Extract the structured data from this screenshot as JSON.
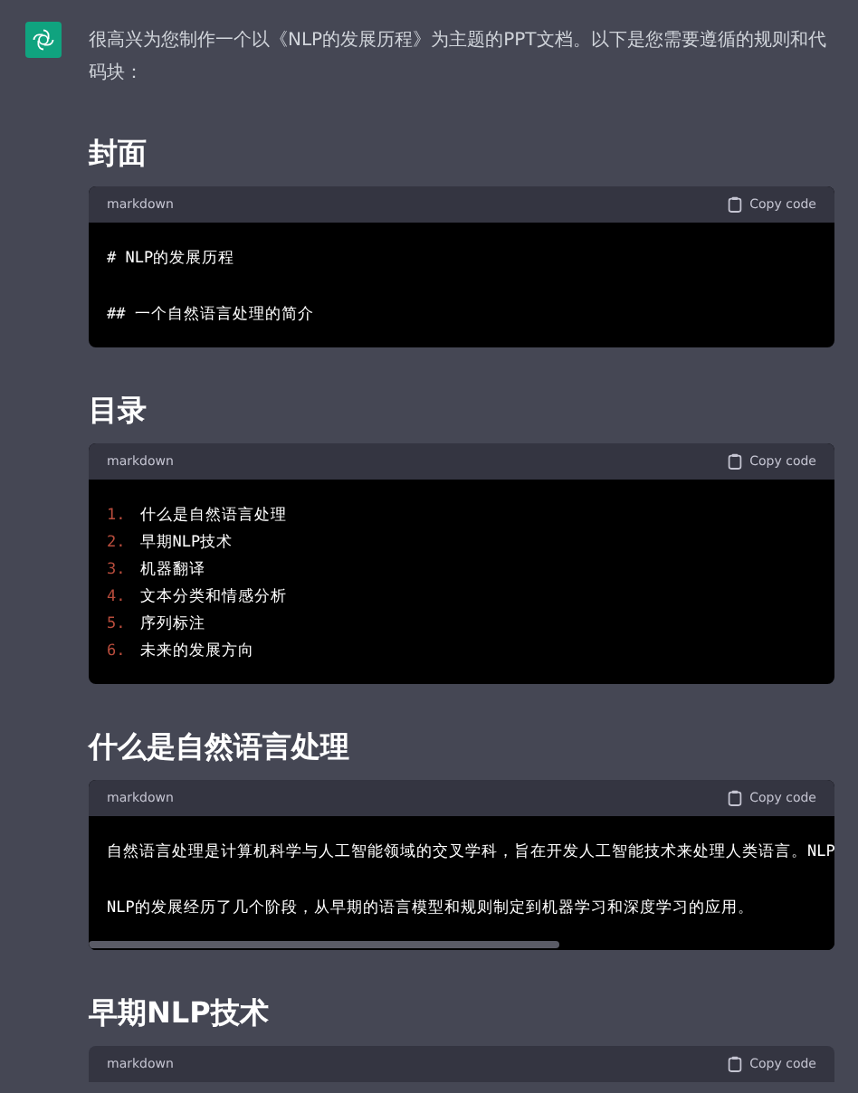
{
  "message": {
    "intro": "很高兴为您制作一个以《NLP的发展历程》为主题的PPT文档。以下是您需要遵循的规则和代码块：",
    "sections": [
      {
        "heading": "封面",
        "code": {
          "language": "markdown",
          "copy_label": "Copy code",
          "kind": "paragraphs",
          "lines": [
            {
              "text": "# NLP的发展历程"
            },
            {
              "text": "## 一个自然语言处理的简介"
            }
          ],
          "scrollbar": false
        }
      },
      {
        "heading": "目录",
        "code": {
          "language": "markdown",
          "copy_label": "Copy code",
          "kind": "list",
          "lines": [
            {
              "number": "1.",
              "text": "什么是自然语言处理"
            },
            {
              "number": "2.",
              "text": "早期NLP技术"
            },
            {
              "number": "3.",
              "text": "机器翻译"
            },
            {
              "number": "4.",
              "text": "文本分类和情感分析"
            },
            {
              "number": "5.",
              "text": "序列标注"
            },
            {
              "number": "6.",
              "text": "未来的发展方向"
            }
          ],
          "scrollbar": false
        }
      },
      {
        "heading": "什么是自然语言处理",
        "code": {
          "language": "markdown",
          "copy_label": "Copy code",
          "kind": "paragraphs",
          "lines": [
            {
              "text": "自然语言处理是计算机科学与人工智能领域的交叉学科，旨在开发人工智能技术来处理人类语言。NLP"
            },
            {
              "text": "NLP的发展经历了几个阶段，从早期的语言模型和规则制定到机器学习和深度学习的应用。"
            }
          ],
          "scrollbar": true
        }
      },
      {
        "heading": "早期NLP技术",
        "code": {
          "language": "markdown",
          "copy_label": "Copy code",
          "kind": "header_only"
        }
      }
    ]
  }
}
